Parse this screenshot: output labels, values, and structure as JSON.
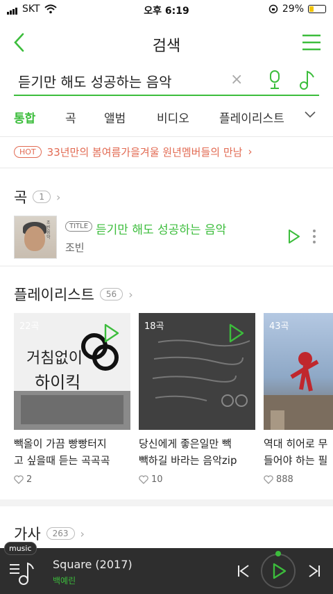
{
  "status": {
    "carrier": "SKT",
    "time": "오후 6:19",
    "battery": "29%",
    "battery_level": 0.29
  },
  "header": {
    "title": "검색",
    "back_icon": "chevron-left-icon",
    "menu_icon": "hamburger-menu-icon"
  },
  "search": {
    "query": "듣기만 해도 성공하는 음악",
    "clear_glyph": "×"
  },
  "tabs": [
    {
      "label": "통합",
      "active": true
    },
    {
      "label": "곡"
    },
    {
      "label": "앨범"
    },
    {
      "label": "비디오"
    },
    {
      "label": "플레이리스트"
    }
  ],
  "hot": {
    "badge": "HOT",
    "text": "33년만의 봄여름가을겨울 원년멤버들의 만남",
    "arrow": "›"
  },
  "songs_section": {
    "label": "곡",
    "count": "1",
    "arrow": "›"
  },
  "song": {
    "badge": "TITLE",
    "title": "듣기만 해도 성공하는 음악",
    "artist": "조빈"
  },
  "playlist_section": {
    "label": "플레이리스트",
    "count": "56",
    "arrow": "›"
  },
  "playlists": [
    {
      "count": "22곡",
      "caption_line1": "빽올이 가끔 빵빵터지",
      "caption_line2": "고 싶을때 듣는 곡곡곡",
      "likes": "2"
    },
    {
      "count": "18곡",
      "caption_line1": "당신에게 좋은일만 빽",
      "caption_line2": "빽하길 바라는 음악zip",
      "likes": "10"
    },
    {
      "count": "43곡",
      "caption_line1": "역대 히어로 무",
      "caption_line2": "들어야 하는 필",
      "likes": "888"
    }
  ],
  "lyrics_section": {
    "label": "가사",
    "count": "263",
    "arrow": "›"
  },
  "player": {
    "tag": "music",
    "track": "Square (2017)",
    "artist": "백예린"
  },
  "colors": {
    "accent": "#3cbd3c",
    "hot": "#e26a52",
    "player_bg": "#2e2e2e"
  }
}
